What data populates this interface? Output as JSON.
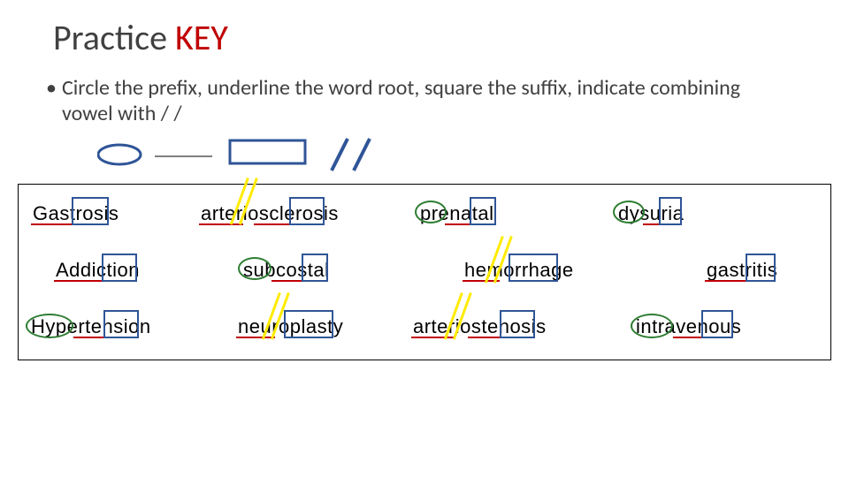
{
  "title_prefix": "Practice ",
  "title_key": "KEY",
  "bullet_text": "Circle the prefix, underline the word root, square the suffix, indicate combining vowel with / /",
  "legend": {
    "circle_label": "prefix",
    "underline_label": "root",
    "square_label": "suffix",
    "slash_label": "combining vowel"
  },
  "words": {
    "r1c1": "Gastrosis",
    "r1c2": "arteriosclerosis",
    "r1c3": "prenatal",
    "r1c4": "dysuria",
    "r2c1": "Addiction",
    "r2c2": "subcostal",
    "r2c3": "hemorrhage",
    "r2c4": "gastritis",
    "r3c1": "Hypertension",
    "r3c2": "neuroplasty",
    "r3c3": "arteriostenosis",
    "r3c4": "intravenous"
  }
}
